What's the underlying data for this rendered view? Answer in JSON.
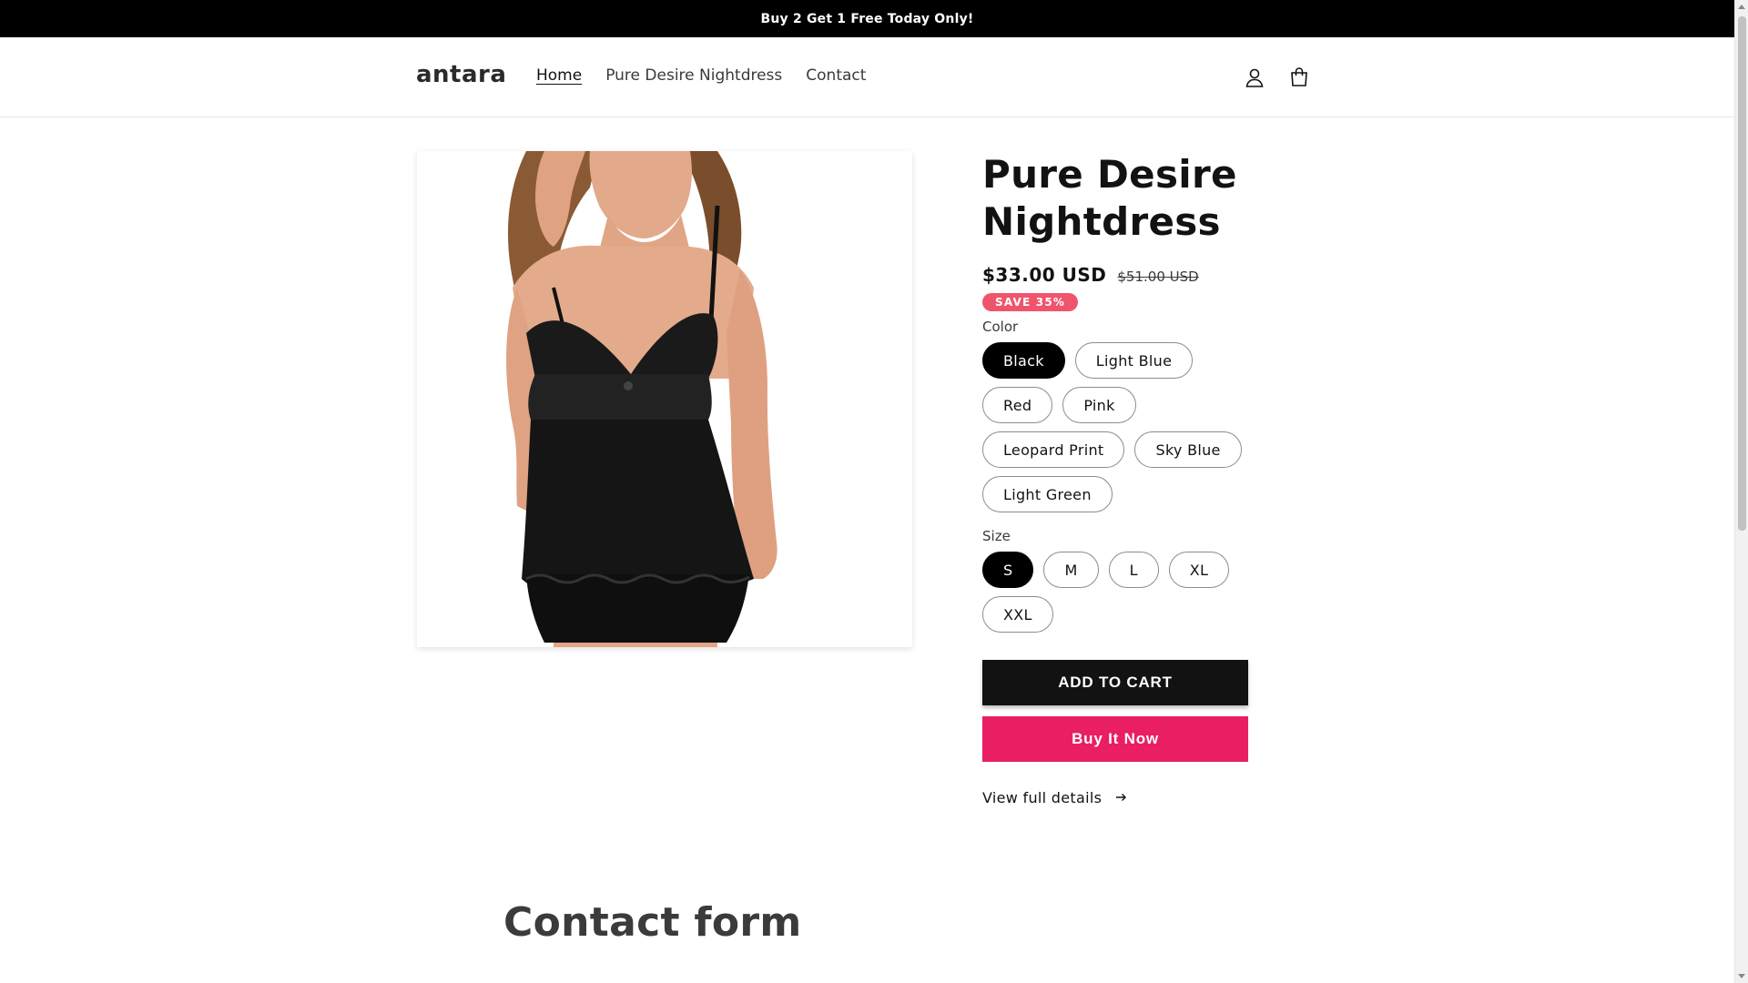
{
  "announcement": {
    "text": "Buy 2 Get 1 Free Today Only!"
  },
  "header": {
    "logo": "antara",
    "nav": [
      {
        "label": "Home",
        "active": true
      },
      {
        "label": "Pure Desire Nightdress",
        "active": false
      },
      {
        "label": "Contact",
        "active": false
      }
    ],
    "icons": [
      "account-icon",
      "cart-icon"
    ]
  },
  "product": {
    "title": "Pure Desire Nightdress",
    "price_sale": "$33.00 USD",
    "price_regular": "$51.00 USD",
    "badge": "SAVE 35%",
    "color_label": "Color",
    "colors": [
      {
        "label": "Black",
        "selected": true
      },
      {
        "label": "Light Blue",
        "selected": false
      },
      {
        "label": "Red",
        "selected": false
      },
      {
        "label": "Pink",
        "selected": false
      },
      {
        "label": "Leopard Print",
        "selected": false
      },
      {
        "label": "Sky Blue",
        "selected": false
      },
      {
        "label": "Light Green",
        "selected": false
      }
    ],
    "size_label": "Size",
    "sizes": [
      {
        "label": "S",
        "selected": true
      },
      {
        "label": "M",
        "selected": false
      },
      {
        "label": "L",
        "selected": false
      },
      {
        "label": "XL",
        "selected": false
      },
      {
        "label": "XXL",
        "selected": false
      }
    ],
    "add_to_cart": "ADD TO CART",
    "buy_now": "Buy It Now",
    "view_details": "View full details",
    "image_icon": "product-image"
  },
  "contact": {
    "heading": "Contact form"
  },
  "colors": {
    "announcement_bg": "#000000",
    "buy_now": "#e91e63",
    "badge": "#f0546c",
    "add_to_cart": "#121212"
  }
}
